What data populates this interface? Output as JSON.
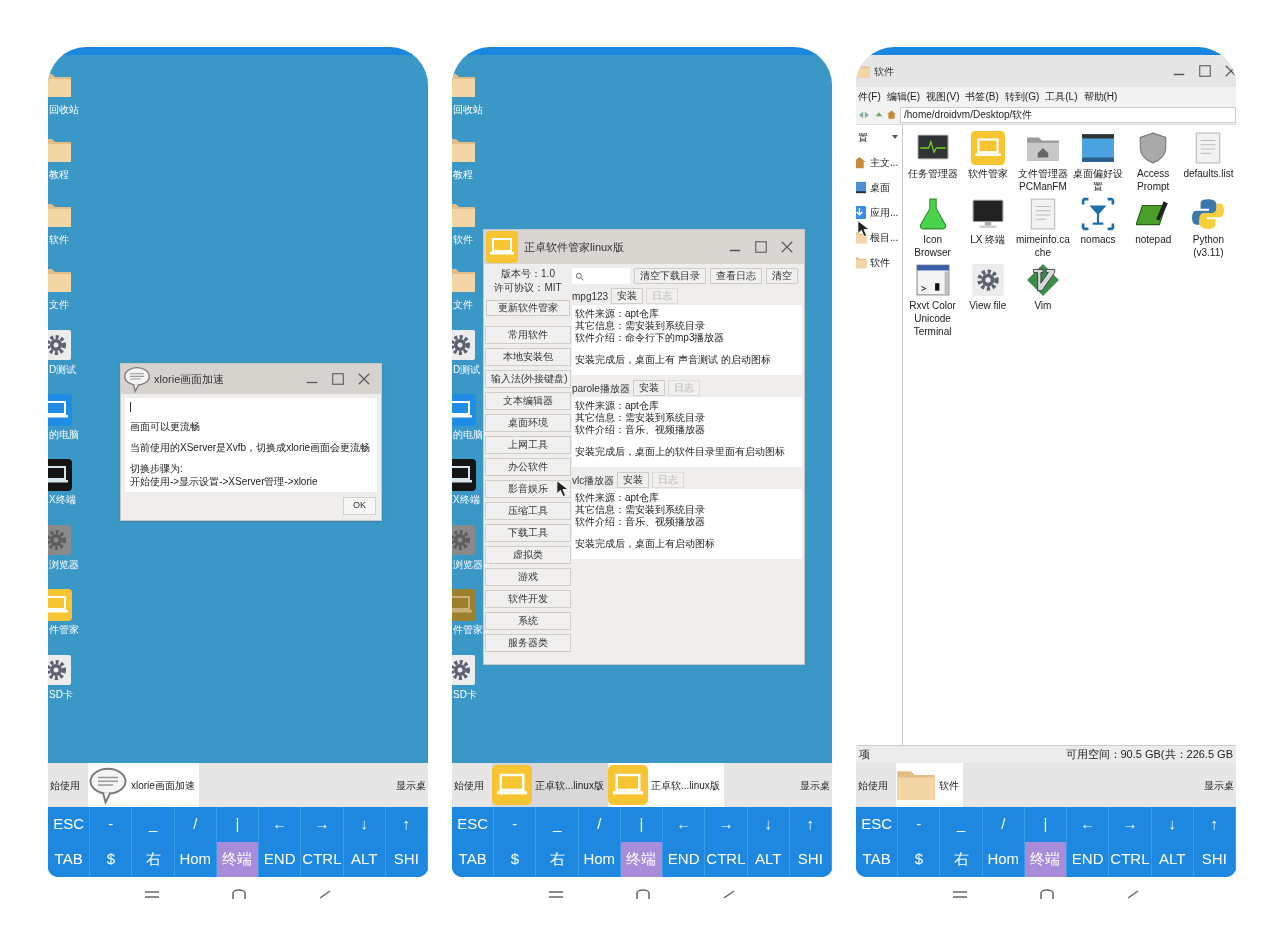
{
  "phones": [
    {
      "desktop_icons": [
        {
          "label": "回收站",
          "kind": "folder"
        },
        {
          "label": "教程",
          "kind": "folder"
        },
        {
          "label": "软件",
          "kind": "folder"
        },
        {
          "label": "文件",
          "kind": "folder"
        },
        {
          "label": "D测试",
          "kind": "gear"
        },
        {
          "label": "的电脑",
          "kind": "laptop_blue"
        },
        {
          "label": "X终端",
          "kind": "laptop_black"
        },
        {
          "label": "浏览器",
          "kind": "gear_dark"
        },
        {
          "label": "件管家",
          "kind": "laptop_yellow"
        },
        {
          "label": "SD卡",
          "kind": "gear"
        }
      ],
      "window": {
        "kind": "message",
        "title": "xlorie画面加速",
        "paragraphs": [
          [
            "画面可以更流畅"
          ],
          [
            "当前使用的XServer是Xvfb，切换成xlorie画面会更流畅"
          ],
          [
            "切换步骤为:",
            "开始使用->显示设置->XServer管理->xlorie"
          ]
        ],
        "button": "OK"
      },
      "taskbar": {
        "start": "始使用",
        "tasks": [
          {
            "label": "xlorie画面加速",
            "kind": "speech",
            "selected": true
          }
        ],
        "show_desktop": "显示桌"
      },
      "keyboard": [
        [
          {
            "label": "ESC",
            "highlighted": false
          },
          {
            "label": "-",
            "highlighted": false
          },
          {
            "label": "_",
            "highlighted": false
          },
          {
            "label": "/",
            "highlighted": false
          },
          {
            "label": "|",
            "highlighted": false
          },
          {
            "label": "←",
            "highlighted": false
          },
          {
            "label": "→",
            "highlighted": false
          },
          {
            "label": "↓",
            "highlighted": false
          },
          {
            "label": "↑",
            "highlighted": false
          }
        ],
        [
          {
            "label": "TAB",
            "highlighted": false
          },
          {
            "label": "$",
            "highlighted": false
          },
          {
            "label": "右",
            "highlighted": false
          },
          {
            "label": "Hom",
            "highlighted": false
          },
          {
            "label": "终端",
            "highlighted": true
          },
          {
            "label": "END",
            "highlighted": false
          },
          {
            "label": "CTRL",
            "highlighted": false
          },
          {
            "label": "ALT",
            "highlighted": false
          },
          {
            "label": "SHI",
            "highlighted": false
          }
        ]
      ]
    },
    {
      "desktop_icons": [
        {
          "label": "回收站",
          "kind": "folder"
        },
        {
          "label": "教程",
          "kind": "folder"
        },
        {
          "label": "软件",
          "kind": "folder"
        },
        {
          "label": "文件",
          "kind": "folder"
        },
        {
          "label": "D测试",
          "kind": "gear"
        },
        {
          "label": "的电脑",
          "kind": "laptop_blue"
        },
        {
          "label": "X终端",
          "kind": "laptop_black"
        },
        {
          "label": "浏览器",
          "kind": "gear_dark"
        },
        {
          "label": "件管家",
          "kind": "laptop_dim"
        },
        {
          "label": "SD卡",
          "kind": "gear"
        }
      ],
      "window": {
        "kind": "software_manager",
        "title": "正卓软件管家linux版",
        "version": "版本号：1.0",
        "license": "许可协议：MIT",
        "update_button": "更新软件管家",
        "categories": [
          "常用软件",
          "本地安装包",
          "输入法(外接键盘)",
          "文本编辑器",
          "桌面环境",
          "上网工具",
          "办公软件",
          "影音娱乐",
          "压缩工具",
          "下载工具",
          "虚拟类",
          "游戏",
          "软件开发",
          "系统",
          "服务器类"
        ],
        "toolbar_buttons": [
          "清空下载目录",
          "查看日志",
          "清空"
        ],
        "packages": [
          {
            "name": "mpg123",
            "install": "安装",
            "log": "日志",
            "log_disabled": true,
            "info": [
              "软件来源：apt仓库",
              "其它信息：需安装到系统目录",
              "软件介绍：命令行下的mp3播放器"
            ],
            "note": "安装完成后，桌面上有 声音测试 的启动图标"
          },
          {
            "name": "parole播放器",
            "install": "安装",
            "log": "日志",
            "log_disabled": true,
            "info": [
              "软件来源：apt仓库",
              "其它信息：需安装到系统目录",
              "软件介绍：音乐、视频播放器"
            ],
            "note": "安装完成后，桌面上的软件目录里面有启动图标"
          },
          {
            "name": "vlc播放器",
            "install": "安装",
            "log": "日志",
            "log_disabled": true,
            "info": [
              "软件来源：apt仓库",
              "其它信息：需安装到系统目录",
              "软件介绍：音乐、视频播放器"
            ],
            "note": "安装完成后，桌面上有启动图标"
          }
        ]
      },
      "taskbar": {
        "start": "始使用",
        "tasks": [
          {
            "label": "正卓软...linux版",
            "kind": "laptop_yellow",
            "selected": false
          },
          {
            "label": "正卓软...linux版",
            "kind": "laptop_yellow",
            "selected": true
          }
        ],
        "show_desktop": "显示桌"
      },
      "keyboard": [
        [
          {
            "label": "ESC",
            "highlighted": false
          },
          {
            "label": "-",
            "highlighted": false
          },
          {
            "label": "_",
            "highlighted": false
          },
          {
            "label": "/",
            "highlighted": false
          },
          {
            "label": "|",
            "highlighted": false
          },
          {
            "label": "←",
            "highlighted": false
          },
          {
            "label": "→",
            "highlighted": false
          },
          {
            "label": "↓",
            "highlighted": false
          },
          {
            "label": "↑",
            "highlighted": false
          }
        ],
        [
          {
            "label": "TAB",
            "highlighted": false
          },
          {
            "label": "$",
            "highlighted": false
          },
          {
            "label": "右",
            "highlighted": false
          },
          {
            "label": "Hom",
            "highlighted": false
          },
          {
            "label": "终端",
            "highlighted": true
          },
          {
            "label": "END",
            "highlighted": false
          },
          {
            "label": "CTRL",
            "highlighted": false
          },
          {
            "label": "ALT",
            "highlighted": false
          },
          {
            "label": "SHI",
            "highlighted": false
          }
        ]
      ]
    },
    {
      "window": {
        "kind": "file_manager",
        "title": "软件",
        "menu": [
          "件(F)",
          "编辑(E)",
          "视图(V)",
          "书签(B)",
          "转到(G)",
          "工具(L)",
          "帮助(H)"
        ],
        "path": "/home/droidvm/Desktop/软件",
        "places_header": "置",
        "places": [
          {
            "label": "主文...",
            "kind": "home"
          },
          {
            "label": "桌面",
            "kind": "desktop"
          },
          {
            "label": "应用...",
            "kind": "apps"
          },
          {
            "label": "根目...",
            "kind": "folder"
          },
          {
            "label": "软件",
            "kind": "folder"
          }
        ],
        "files": [
          {
            "label": "任务管理器",
            "kind": "monitor"
          },
          {
            "label": "软件管家",
            "kind": "laptop_yellow"
          },
          {
            "label": "文件管理器 PCManFM",
            "kind": "folder_home"
          },
          {
            "label": "桌面偏好设置",
            "kind": "panel"
          },
          {
            "label": "Access Prompt",
            "kind": "shield"
          },
          {
            "label": "defaults.list",
            "kind": "doc"
          },
          {
            "label": "Icon Browser",
            "kind": "flask"
          },
          {
            "label": "LX 终端",
            "kind": "screen"
          },
          {
            "label": "mimeinfo.cache",
            "kind": "doc"
          },
          {
            "label": "nomacs",
            "kind": "glass"
          },
          {
            "label": "notepad",
            "kind": "notepad"
          },
          {
            "label": "Python (v3.11)",
            "kind": "python"
          },
          {
            "label": "Rxvt Color Unicode Terminal",
            "kind": "terminal"
          },
          {
            "label": "View file",
            "kind": "gear"
          },
          {
            "label": "Vim",
            "kind": "vim"
          }
        ],
        "status_left": "项",
        "status_right": "可用空间：90.5 GB(共：226.5 GB"
      },
      "taskbar": {
        "start": "始使用",
        "tasks": [
          {
            "label": "软件",
            "kind": "folder",
            "selected": true
          }
        ],
        "show_desktop": "显示桌"
      },
      "keyboard": [
        [
          {
            "label": "ESC",
            "highlighted": false
          },
          {
            "label": "-",
            "highlighted": false
          },
          {
            "label": "_",
            "highlighted": false
          },
          {
            "label": "/",
            "highlighted": false
          },
          {
            "label": "|",
            "highlighted": false
          },
          {
            "label": "←",
            "highlighted": false
          },
          {
            "label": "→",
            "highlighted": false
          },
          {
            "label": "↓",
            "highlighted": false
          },
          {
            "label": "↑",
            "highlighted": false
          }
        ],
        [
          {
            "label": "TAB",
            "highlighted": false
          },
          {
            "label": "$",
            "highlighted": false
          },
          {
            "label": "右",
            "highlighted": false
          },
          {
            "label": "Hom",
            "highlighted": false
          },
          {
            "label": "终端",
            "highlighted": true
          },
          {
            "label": "END",
            "highlighted": false
          },
          {
            "label": "CTRL",
            "highlighted": false
          },
          {
            "label": "ALT",
            "highlighted": false
          },
          {
            "label": "SHI",
            "highlighted": false
          }
        ]
      ]
    }
  ]
}
